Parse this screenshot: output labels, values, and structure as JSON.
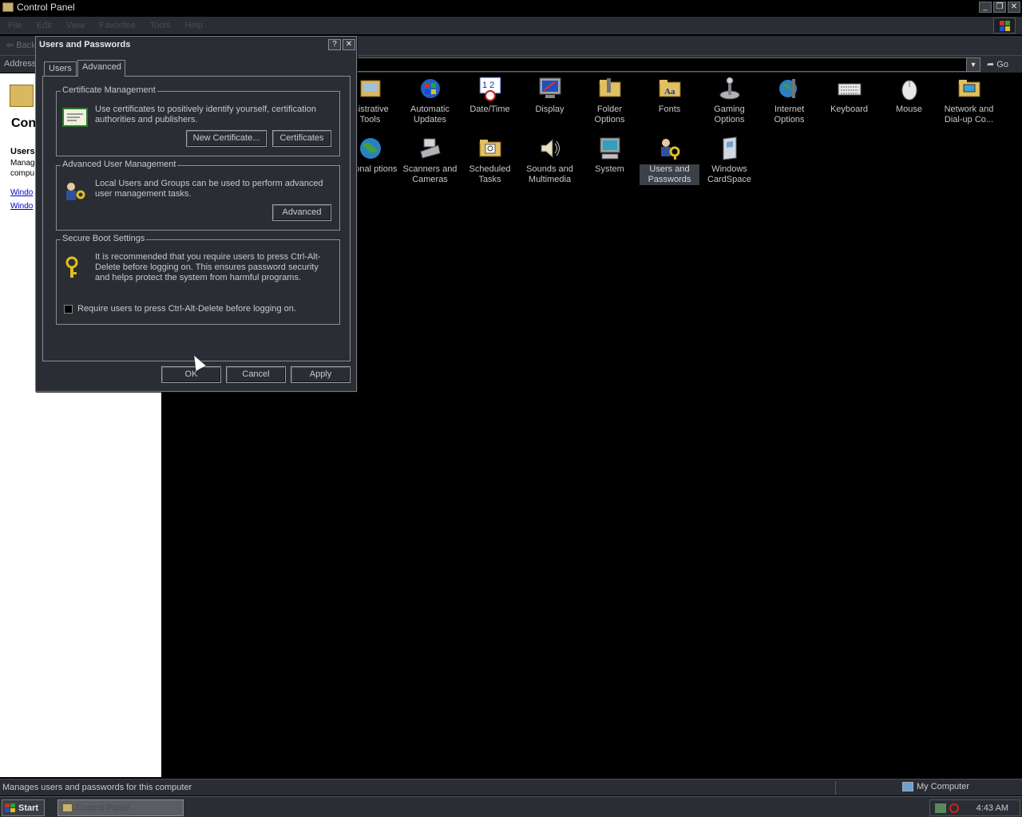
{
  "window": {
    "title": "Control Panel",
    "minimize": "_",
    "restore": "❐",
    "close": "✕"
  },
  "menu": [
    "File",
    "Edit",
    "View",
    "Favorites",
    "Tools",
    "Help"
  ],
  "toolbar": {
    "back_label": "Back"
  },
  "address": {
    "label": "Address",
    "go_label": "Go"
  },
  "left_pane": {
    "title": "Con",
    "selected_title": "Users",
    "selected_desc": "Manag compu",
    "links": [
      "Windo",
      "Windo"
    ]
  },
  "icons": [
    {
      "label": "inistrative Tools",
      "icon": "admin-tools-icon"
    },
    {
      "label": "Automatic Updates",
      "icon": "automatic-updates-icon"
    },
    {
      "label": "Date/Time",
      "icon": "date-time-icon"
    },
    {
      "label": "Display",
      "icon": "display-icon"
    },
    {
      "label": "Folder Options",
      "icon": "folder-options-icon"
    },
    {
      "label": "Fonts",
      "icon": "fonts-icon"
    },
    {
      "label": "Gaming Options",
      "icon": "gaming-options-icon"
    },
    {
      "label": "Internet Options",
      "icon": "internet-options-icon"
    },
    {
      "label": "Keyboard",
      "icon": "keyboard-icon"
    },
    {
      "label": "Mouse",
      "icon": "mouse-icon"
    },
    {
      "label": "Network and Dial-up Co...",
      "icon": "network-icon"
    },
    {
      "label": "egional ptions",
      "icon": "regional-options-icon"
    },
    {
      "label": "Scanners and Cameras",
      "icon": "scanners-icon"
    },
    {
      "label": "Scheduled Tasks",
      "icon": "scheduled-tasks-icon"
    },
    {
      "label": "Sounds and Multimedia",
      "icon": "sounds-icon"
    },
    {
      "label": "System",
      "icon": "system-icon"
    },
    {
      "label": "Users and Passwords",
      "icon": "users-passwords-icon",
      "selected": true
    },
    {
      "label": "Windows CardSpace",
      "icon": "cardspace-icon"
    }
  ],
  "status": {
    "message": "Manages users and passwords for this computer",
    "zone": "My Computer"
  },
  "taskbar": {
    "start": "Start",
    "task": "Control Panel",
    "clock": "4:43 AM"
  },
  "dialog": {
    "title": "Users and Passwords",
    "help": "?",
    "close": "✕",
    "tabs": [
      "Users",
      "Advanced"
    ],
    "cert": {
      "title": "Certificate Management",
      "text": "Use certificates to positively identify yourself, certification authorities and publishers.",
      "new_btn": "New Certificate...",
      "certs_btn": "Certificates"
    },
    "adv": {
      "title": "Advanced User Management",
      "text": "Local Users and Groups can be used to perform advanced user management tasks.",
      "btn": "Advanced"
    },
    "boot": {
      "title": "Secure Boot Settings",
      "text": "It is recommended that you require users to press Ctrl-Alt-Delete before logging on. This ensures password security and helps protect the system from harmful programs.",
      "checkbox": "Require users to press Ctrl-Alt-Delete before logging on."
    },
    "ok": "OK",
    "cancel": "Cancel",
    "apply": "Apply"
  },
  "colors": {
    "ui_dark": "#2a2e34",
    "desktop": "#000000",
    "selection": "#3c4048"
  }
}
